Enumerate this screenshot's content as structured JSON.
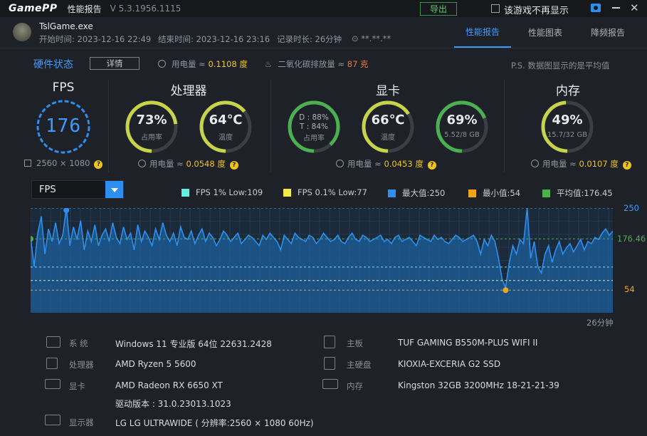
{
  "app": {
    "logo_a": "Game",
    "logo_b": "PP",
    "title": "性能报告",
    "version": "V 5.3.1956.1115"
  },
  "topbar": {
    "export": "导出",
    "no_show": "该游戏不再显示"
  },
  "game": {
    "name": "TslGame.exe",
    "start": "开始时间: 2023-12-16 22:49",
    "end": "结束时间: 2023-12-16 23:16",
    "duration": "记录时长: 26分钟",
    "location": "**.**.**"
  },
  "tabs": [
    "性能报告",
    "性能图表",
    "降频报告"
  ],
  "hw": {
    "title": "硬件状态",
    "detail": "详情",
    "power_label": "用电量 ≈ ",
    "power_val": "0.1108 度",
    "co2_label": "二氧化碳排放量 ≈ ",
    "co2_val": "87 克",
    "note": "P.S. 数据图显示的是平均值"
  },
  "fps": {
    "title": "FPS",
    "value": "176",
    "res": "2560 × 1080"
  },
  "cpu": {
    "title": "处理器",
    "usage": "73%",
    "usage_lbl": "占用率",
    "temp": "64℃",
    "temp_lbl": "温度",
    "power_label": "用电量 ≈ ",
    "power_val": "0.0548 度",
    "usage_frac": 0.73,
    "temp_frac": 0.64
  },
  "gpu": {
    "title": "显卡",
    "d": "D : 88%",
    "t": "T : 84%",
    "usage_lbl": "占用率",
    "temp": "66℃",
    "temp_lbl": "温度",
    "mem": "69%",
    "mem_sub": "5.52/8 GB",
    "power_label": "用电量 ≈ ",
    "power_val": "0.0453 度",
    "d_frac": 0.88,
    "temp_frac": 0.66,
    "mem_frac": 0.69
  },
  "ram": {
    "title": "内存",
    "usage": "49%",
    "sub": "15.7/32 GB",
    "power_label": "用电量 ≈ ",
    "power_val": "0.0107 度",
    "usage_frac": 0.49
  },
  "metric_select": "FPS",
  "legend": [
    {
      "label": "FPS 1% Low:109",
      "color": "#5ff2e0"
    },
    {
      "label": "FPS 0.1% Low:77",
      "color": "#f5e94a"
    },
    {
      "label": "最大值:250",
      "color": "#2d8ff0"
    },
    {
      "label": "最小值:54",
      "color": "#f0a418"
    },
    {
      "label": "平均值:176.45",
      "color": "#4caf50"
    }
  ],
  "chart_data": {
    "type": "area",
    "ylim": [
      0,
      250
    ],
    "max": 250,
    "min": 54,
    "avg": 176.46,
    "low1": 109,
    "low01": 77,
    "max_label": "250",
    "avg_label": "176.46",
    "min_label": "54",
    "time_label": "26分钟",
    "values": [
      180,
      110,
      190,
      230,
      140,
      200,
      170,
      215,
      165,
      185,
      250,
      160,
      205,
      175,
      220,
      150,
      195,
      170,
      210,
      160,
      185,
      200,
      170,
      215,
      180,
      165,
      205,
      175,
      190,
      150,
      210,
      170,
      195,
      180,
      160,
      200,
      175,
      215,
      185,
      170,
      190,
      160,
      205,
      180,
      175,
      195,
      165,
      185,
      200,
      170,
      190,
      180,
      160,
      175,
      195,
      185,
      170,
      180,
      190,
      165,
      175,
      185,
      180,
      170,
      160,
      185,
      175,
      190,
      180,
      170,
      150,
      185,
      175,
      165,
      190,
      180,
      175,
      170,
      185,
      180,
      165,
      175,
      190,
      180,
      170,
      175,
      185,
      170,
      165,
      180,
      190,
      175,
      170,
      185,
      180,
      170,
      175,
      180,
      185,
      170,
      175,
      165,
      180,
      185,
      170,
      175,
      180,
      170,
      160,
      185,
      180,
      175,
      170,
      185,
      175,
      180,
      170,
      165,
      175,
      185,
      180,
      170,
      175,
      180,
      185,
      170,
      140,
      175,
      160,
      185,
      170,
      130,
      80,
      60,
      120,
      160,
      140,
      175,
      165,
      250,
      130,
      170,
      110,
      95,
      140,
      160,
      120,
      150,
      170,
      140,
      155,
      165,
      145,
      160,
      175,
      150,
      170,
      165,
      180,
      175,
      190,
      200,
      185,
      195
    ]
  },
  "specs": {
    "os_k": "系 统",
    "os_v": "Windows 11 专业版 64位 22631.2428",
    "cpu_k": "处理器",
    "cpu_v": "AMD Ryzen 5 5600",
    "gpu_k": "显卡",
    "gpu_v": "AMD Radeon RX 6650 XT",
    "driver_v": "驱动版本 : 31.0.23013.1023",
    "mon_k": "显示器",
    "mon_v": "LG LG ULTRAWIDE ( 分辨率:2560 × 1080 60Hz)",
    "mb_k": "主板",
    "mb_v": "TUF GAMING B550M-PLUS WIFI II",
    "disk_k": "主硬盘",
    "disk_v": "KIOXIA-EXCERIA G2 SSD",
    "mem_k": "内存",
    "mem_v": "Kingston 32GB 3200MHz 18-21-21-39"
  }
}
